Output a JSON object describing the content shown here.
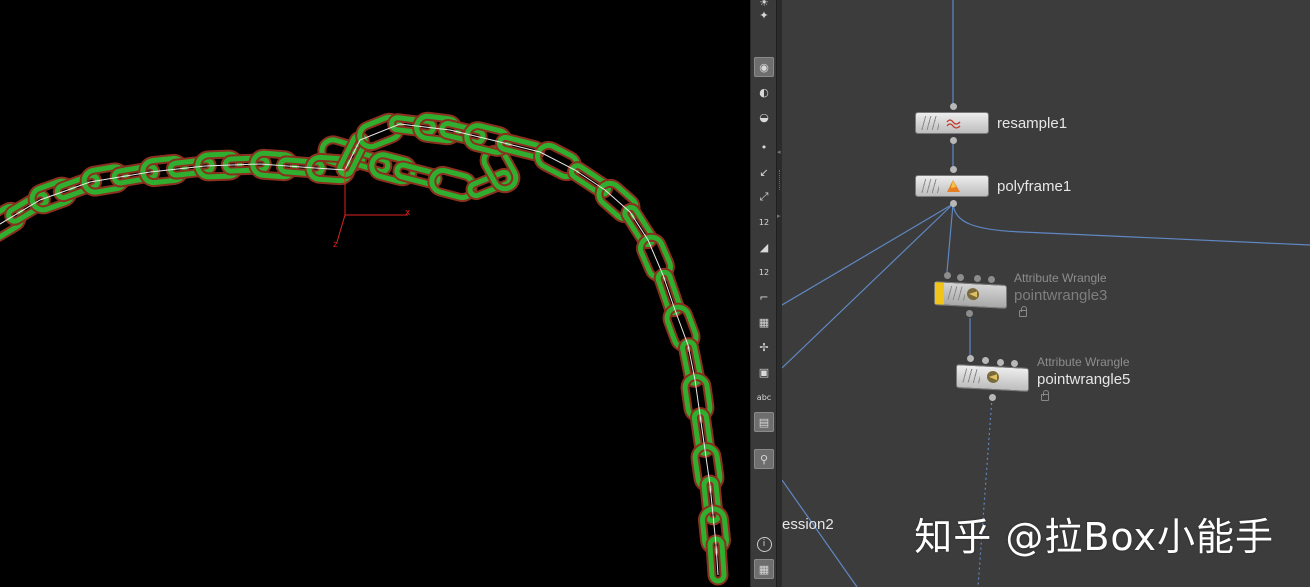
{
  "viewport": {
    "axis_label_x": "x",
    "axis_label_z": "z"
  },
  "toolbar": {
    "tools": [
      {
        "icon": "light-icon"
      },
      {
        "icon": "camera-light-icon"
      },
      {
        "icon": "shading-mode-icon",
        "active": true
      },
      {
        "icon": "visibility-icon"
      },
      {
        "icon": "ghost-icon"
      },
      {
        "icon": "point-display-icon"
      },
      {
        "icon": "normals-icon"
      },
      {
        "icon": "point-normals-icon"
      },
      {
        "icon": "point-numbers-icon",
        "label": "12"
      },
      {
        "icon": "primitive-normals-icon"
      },
      {
        "icon": "primitive-numbers-icon",
        "label": "12"
      },
      {
        "icon": "bounding-box-icon"
      },
      {
        "icon": "snap-grid-icon"
      },
      {
        "icon": "transform-handle-icon"
      },
      {
        "icon": "display-options-icon"
      },
      {
        "icon": "text-display-icon",
        "label": "abc"
      },
      {
        "icon": "background-image-icon",
        "active": true
      },
      {
        "icon": "flipbook-icon",
        "active": true
      },
      {
        "icon": "info-icon",
        "label": "i"
      },
      {
        "icon": "grid-layout-icon",
        "active": true
      }
    ]
  },
  "network": {
    "nodes": [
      {
        "name": "resample1",
        "type": "",
        "icon": "resample-icon",
        "state": "normal"
      },
      {
        "name": "polyframe1",
        "type": "",
        "icon": "polyframe-icon",
        "state": "normal"
      },
      {
        "name": "pointwrangle3",
        "type": "Attribute Wrangle",
        "icon": "wrangle-icon",
        "state": "bypassed"
      },
      {
        "name": "pointwrangle5",
        "type": "Attribute Wrangle",
        "icon": "wrangle-icon",
        "state": "normal"
      }
    ],
    "partial_node_label": "ession2",
    "wire_color": "#5f87c2",
    "bypass_flag_color": "#f0c419"
  },
  "watermark": "知乎 @拉Box小能手"
}
